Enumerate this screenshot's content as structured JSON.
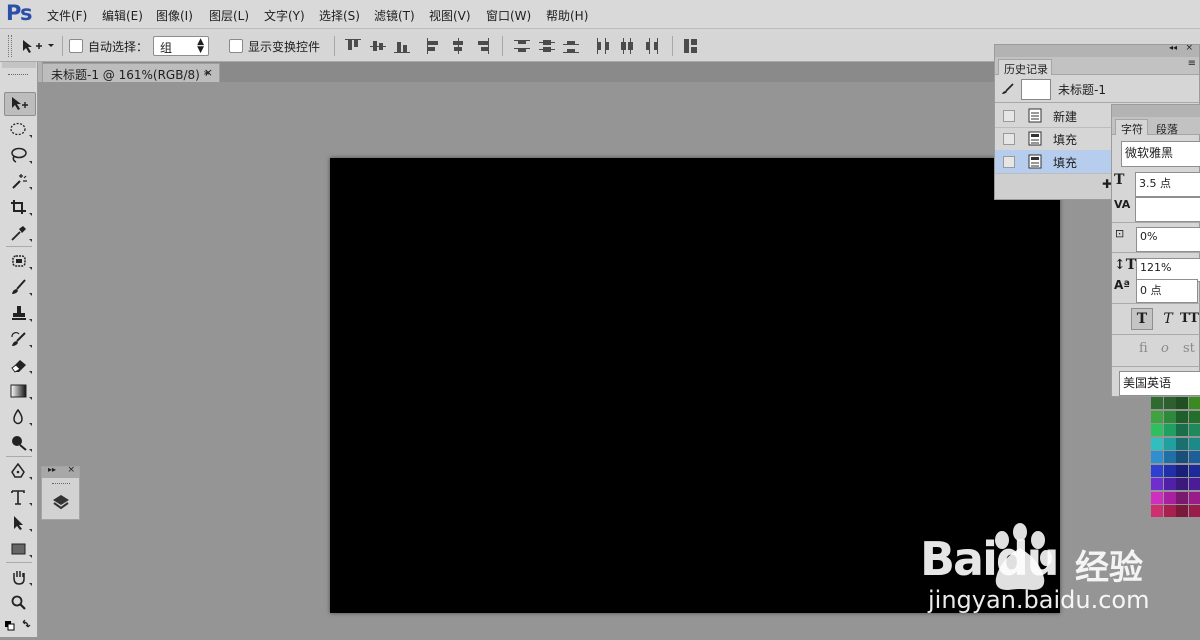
{
  "app": {
    "logo": "Ps"
  },
  "menu": [
    "文件(F)",
    "编辑(E)",
    "图像(I)",
    "图层(L)",
    "文字(Y)",
    "选择(S)",
    "滤镜(T)",
    "视图(V)",
    "窗口(W)",
    "帮助(H)"
  ],
  "options": {
    "auto_select_label": "自动选择：",
    "auto_select_value": "组",
    "show_transform_label": "显示变换控件"
  },
  "document": {
    "tab_title": "未标题-1 @ 161%(RGB/8) *",
    "close": "×",
    "canvas_color": "#000000"
  },
  "history": {
    "tab": "历史记录",
    "snapshot": "未标题-1",
    "items": [
      {
        "label": "新建",
        "selected": false
      },
      {
        "label": "填充",
        "selected": false
      },
      {
        "label": "填充",
        "selected": true
      }
    ]
  },
  "character": {
    "tabs": [
      "字符",
      "段落"
    ],
    "font_family": "微软雅黑",
    "font_size": "3.5 点",
    "tracking": "0%",
    "vertical_scale": "121%",
    "baseline_shift": "0 点",
    "language": "美国英语",
    "style_glyphs": [
      "T",
      "T",
      "TT"
    ],
    "ligature_glyphs": [
      "fi",
      "o",
      "st"
    ]
  },
  "watermark": {
    "brand": "Baidu",
    "cn": "经验",
    "url": "jingyan.baidu.com"
  },
  "colors": {
    "accent": "#2b4ea8",
    "selection": "#b6cdee",
    "canvas": "#000000",
    "workspace": "#959595"
  }
}
